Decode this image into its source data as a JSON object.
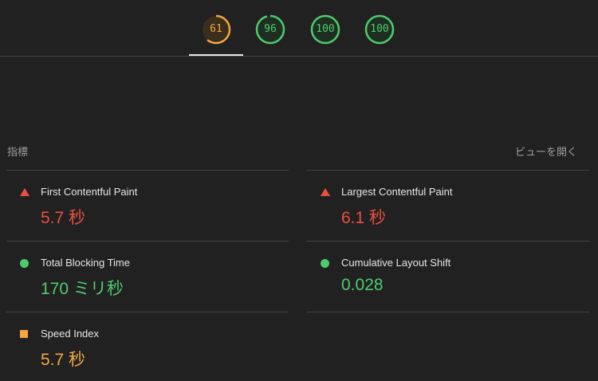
{
  "scores": [
    {
      "value": "61",
      "fraction": 0.61,
      "color": "#f4a742",
      "status": "average"
    },
    {
      "value": "96",
      "fraction": 0.96,
      "color": "#4fcb6e",
      "status": "pass"
    },
    {
      "value": "100",
      "fraction": 1.0,
      "color": "#4fcb6e",
      "status": "pass"
    },
    {
      "value": "100",
      "fraction": 1.0,
      "color": "#4fcb6e",
      "status": "pass"
    }
  ],
  "metrics_section": {
    "title": "指標",
    "expand_label": "ビューを開く"
  },
  "metrics": {
    "fcp": {
      "label": "First Contentful Paint",
      "value": "5.7 秒",
      "icon": "fail-triangle-icon",
      "color": "#ea4f43"
    },
    "lcp": {
      "label": "Largest Contentful Paint",
      "value": "6.1 秒",
      "icon": "fail-triangle-icon",
      "color": "#ea4f43"
    },
    "tbt": {
      "label": "Total Blocking Time",
      "value": "170 ミリ秒",
      "icon": "pass-circle-icon",
      "color": "#4fcb6e"
    },
    "cls": {
      "label": "Cumulative Layout Shift",
      "value": "0.028",
      "icon": "pass-circle-icon",
      "color": "#4fcb6e"
    },
    "si": {
      "label": "Speed Index",
      "value": "5.7 秒",
      "icon": "average-square-icon",
      "color": "#f4a742"
    }
  }
}
